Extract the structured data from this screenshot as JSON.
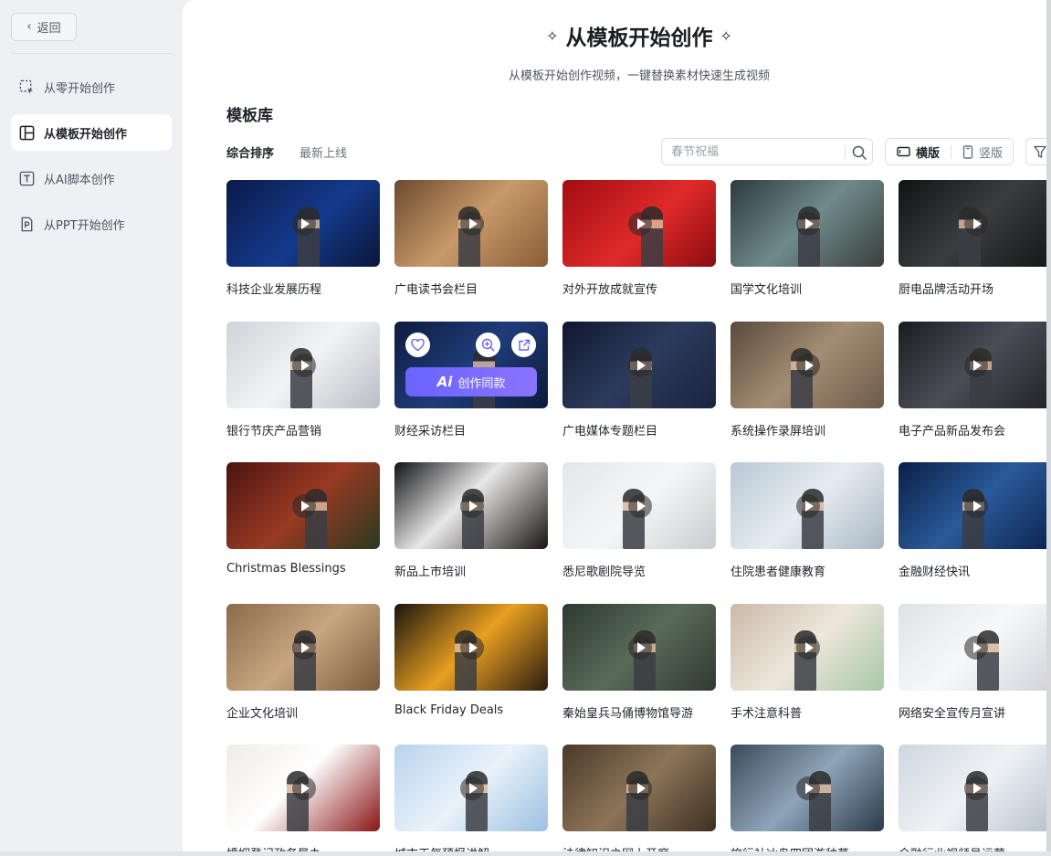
{
  "sidebar": {
    "back_label": "返回",
    "items": [
      {
        "label": "从零开始创作",
        "icon": "select-frame-icon",
        "active": false
      },
      {
        "label": "从模板开始创作",
        "icon": "template-layout-icon",
        "active": true
      },
      {
        "label": "从AI脚本创作",
        "icon": "text-t-icon",
        "active": false
      },
      {
        "label": "从PPT开始创作",
        "icon": "ppt-file-icon",
        "active": false
      }
    ]
  },
  "header": {
    "title": "从模板开始创作",
    "subtitle": "从模板开始创作视频，一键替换素材快速生成视频"
  },
  "library": {
    "title": "模板库",
    "sort": {
      "active": "综合排序",
      "second": "最新上线"
    },
    "search_placeholder": "春节祝福",
    "orientation": {
      "landscape": "横版",
      "portrait": "竖版"
    }
  },
  "hover_card": {
    "ai_label": "创作同款",
    "ai_mark": "Ai"
  },
  "templates": [
    {
      "title": "科技企业发展历程",
      "bg": "linear-gradient(135deg,#0b1a4a,#143a8c 55%,#0a1638)"
    },
    {
      "title": "广电读书会栏目",
      "bg": "linear-gradient(135deg,#6b4a2e,#c89a6a 50%,#8a5c36)"
    },
    {
      "title": "对外开放成就宣传",
      "bg": "linear-gradient(135deg,#a10d12,#e02a2a 55%,#8a0b10)"
    },
    {
      "title": "国学文化培训",
      "bg": "linear-gradient(135deg,#2e3a3e,#6f8a8c 50%,#3a3f3c)"
    },
    {
      "title": "厨电品牌活动开场",
      "bg": "linear-gradient(135deg,#101214,#3a3d40 50%,#141618)"
    },
    {
      "title": "银行节庆产品营销",
      "bg": "linear-gradient(135deg,#cfd3d8,#f2f3f5 50%,#b9bec5)"
    },
    {
      "title": "财经采访栏目",
      "bg": "linear-gradient(135deg,#0d1c3e,#1f3c7a 50%,#0c1a36)"
    },
    {
      "title": "广电媒体专题栏目",
      "bg": "linear-gradient(135deg,#10182e,#2c3a5c 50%,#1a2440)"
    },
    {
      "title": "系统操作录屏培训",
      "bg": "linear-gradient(135deg,#5a4a3a,#a38d74 50%,#6d5a48)"
    },
    {
      "title": "电子产品新品发布会",
      "bg": "linear-gradient(135deg,#1a1c20,#4a4e55 50%,#202226)"
    },
    {
      "title": "Christmas Blessings",
      "bg": "linear-gradient(135deg,#4a1410,#9a3a22 50%,#2a3a20)"
    },
    {
      "title": "新品上市培训",
      "bg": "linear-gradient(135deg,#111214,#e8e8e8 45%,#1a1410)"
    },
    {
      "title": "悉尼歌剧院导览",
      "bg": "linear-gradient(135deg,#e4e6e8,#f5f6f7 50%,#c9ccd0)"
    },
    {
      "title": "住院患者健康教育",
      "bg": "linear-gradient(135deg,#b9c8d4,#e6ecf1 50%,#a9b8c4)"
    },
    {
      "title": "金融财经快讯",
      "bg": "linear-gradient(135deg,#0a1e46,#2a5a9a 50%,#0c2450)"
    },
    {
      "title": "企业文化培训",
      "bg": "linear-gradient(135deg,#8a6a4a,#c8a682 50%,#7a5a3a)"
    },
    {
      "title": "Black Friday Deals",
      "bg": "linear-gradient(135deg,#1a1410,#e8a020 50%,#2a1c10)"
    },
    {
      "title": "秦始皇兵马俑博物馆导游",
      "bg": "linear-gradient(135deg,#2c3a30,#5a6a58 50%,#303a32)"
    },
    {
      "title": "手术注意科普",
      "bg": "linear-gradient(135deg,#c9b9a9,#eee6dc 50%,#a8c8a8)"
    },
    {
      "title": "网络安全宣传月宣讲",
      "bg": "linear-gradient(135deg,#dfe2e6,#f7f8f9 50%,#cfd4da)"
    },
    {
      "title": "婚姻登记政务导办",
      "bg": "linear-gradient(135deg,#f0ece6,#ffffff 45%,#8a1414)"
    },
    {
      "title": "城市天气预报讲解",
      "bg": "linear-gradient(135deg,#b8d4ee,#eaf2fa 50%,#9cc0e0)"
    },
    {
      "title": "法律知识之网上开庭",
      "bg": "linear-gradient(135deg,#4a3a2a,#8c7458 50%,#3e3022)"
    },
    {
      "title": "旅行社冰岛四团游种草",
      "bg": "linear-gradient(135deg,#3a4a5a,#8fa4b8 50%,#2a3a4a)"
    },
    {
      "title": "金融行业视频号运营",
      "bg": "linear-gradient(135deg,#cfd6de,#eef2f6 50%,#b8c2cc)"
    }
  ]
}
